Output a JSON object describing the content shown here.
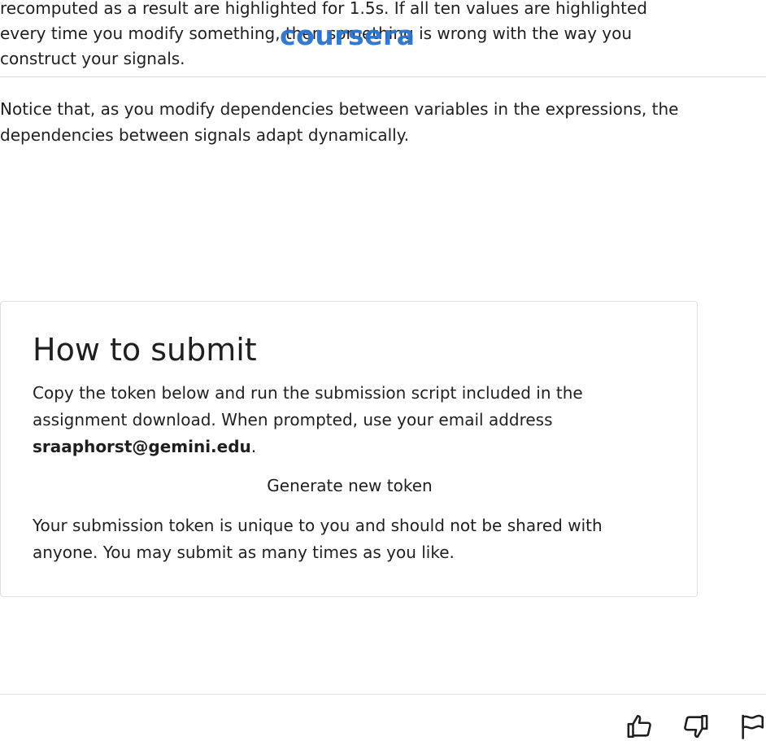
{
  "content": {
    "intro": {
      "line1": "recomputed as a result are highlighted for 1.5s. If all ten values are highlighted",
      "line2": "every time you modify something, then something is wrong with the way you",
      "line3": "construct your signals."
    },
    "notice": "Notice that, as you modify dependencies between variables in the expressions, the dependencies between signals adapt dynamically."
  },
  "logo": {
    "text": "coursera",
    "color": "#2a73cc"
  },
  "submit": {
    "title": "How to submit",
    "instruction_prefix": "Copy the token below and run the submission script included in the assignment download. When prompted, use your email address",
    "email": "sraaphorst@gemini.edu",
    "instruction_suffix": ".",
    "generate_button_label": "Generate new token",
    "token_note": "Your submission token is unique to you and should not be shared with anyone. You may submit as many times as you like."
  },
  "feedback": {
    "icons": [
      "thumbs-up-icon",
      "thumbs-down-icon",
      "flag-icon"
    ]
  }
}
